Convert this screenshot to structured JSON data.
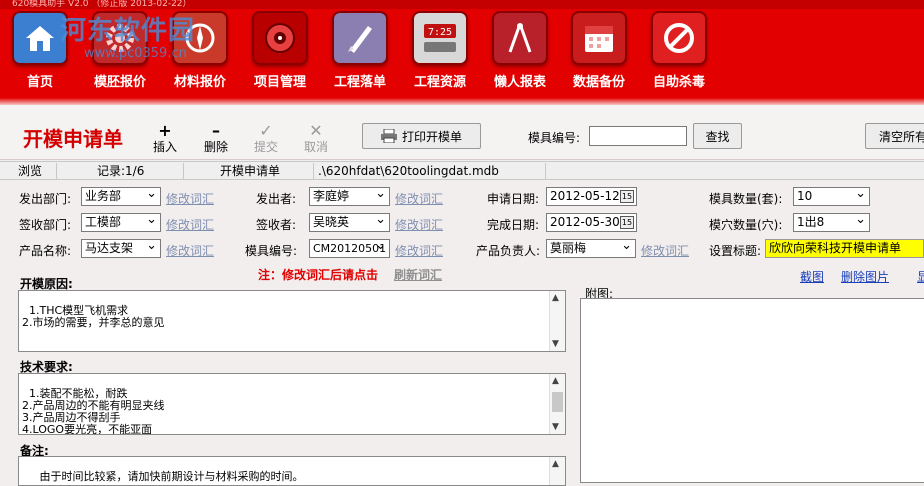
{
  "titlebar": {
    "text": "620模具助手 V2.0     （修正版 2013-02-22）"
  },
  "watermark": {
    "main": "河东软件园",
    "sub": "www.pc0359.cn"
  },
  "toolbar": {
    "items": [
      {
        "label": "首页",
        "color": "#4a8ed8"
      },
      {
        "label": "模胚报价",
        "color": "#c0282a"
      },
      {
        "label": "材料报价",
        "color": "#c93a2a"
      },
      {
        "label": "项目管理",
        "color": "#b80000"
      },
      {
        "label": "工程落单",
        "color": "#8a7fb0"
      },
      {
        "label": "工程资源",
        "color": "#d8d8d8"
      },
      {
        "label": "懒人报表",
        "color": "#b8202a"
      },
      {
        "label": "数据备份",
        "color": "#c91c1c"
      },
      {
        "label": "自助杀毒",
        "color": "#e02020"
      }
    ]
  },
  "form": {
    "title": "开模申请单",
    "actions": {
      "insert": {
        "glyph": "+",
        "label": "插入"
      },
      "delete": {
        "glyph": "–",
        "label": "删除"
      },
      "submit": {
        "glyph": "✓",
        "label": "提交"
      },
      "cancel": {
        "glyph": "✕",
        "label": "取消"
      }
    },
    "print_label": "打印开模单",
    "mold_no_label": "模具编号:",
    "mold_no_value": "",
    "search_label": "查找",
    "clear_label": "清空所有"
  },
  "status": {
    "view": "浏览",
    "record": "记录:1/6",
    "form": "开模申请单",
    "path": ".\\620hfdat\\620toolingdat.mdb"
  },
  "fields": {
    "edit_link": "修改词汇",
    "dept_out_label": "发出部门:",
    "dept_out_value": "业务部",
    "sender_label": "发出者:",
    "sender_value": "李庭婷",
    "apply_date_label": "申请日期:",
    "apply_date_value": "2012-05-12",
    "mold_qty_label": "模具数量(套):",
    "mold_qty_value": "10",
    "dept_in_label": "签收部门:",
    "dept_in_value": "工模部",
    "receiver_label": "签收者:",
    "receiver_value": "吴晓英",
    "finish_date_label": "完成日期:",
    "finish_date_value": "2012-05-30",
    "cavity_label": "模穴数量(穴):",
    "cavity_value": "1出8",
    "product_label": "产品名称:",
    "product_value": "马达支架",
    "mold_code_label": "模具编号:",
    "mold_code_value": "CM20120501",
    "owner_label": "产品负责人:",
    "owner_value": "莫丽梅",
    "set_title_label": "设置标题:",
    "set_title_value": "欣欣向荣科技开模申请单",
    "cal_glyph": "15"
  },
  "notes": {
    "hint": "注：修改词汇后请点击",
    "refresh": "刷新词汇"
  },
  "sections": {
    "reason_label": "开模原因:",
    "reason_text": "1.THC模型飞机需求\n2.市场的需要，并李总的意见",
    "tech_label": "技术要求:",
    "tech_text": "1.装配不能松，耐跌\n2.产品周边的不能有明显夹线\n3.产品周边不得刮手\n4.LOGO要光亮，不能亚面",
    "remark_label": "备注:",
    "remark_text": "   由于时间比较紧，请加快前期设计与材料采购的时间。"
  },
  "attachment": {
    "label": "附图:",
    "screenshot": "截图",
    "delete_image": "删除图片",
    "more": "显"
  }
}
